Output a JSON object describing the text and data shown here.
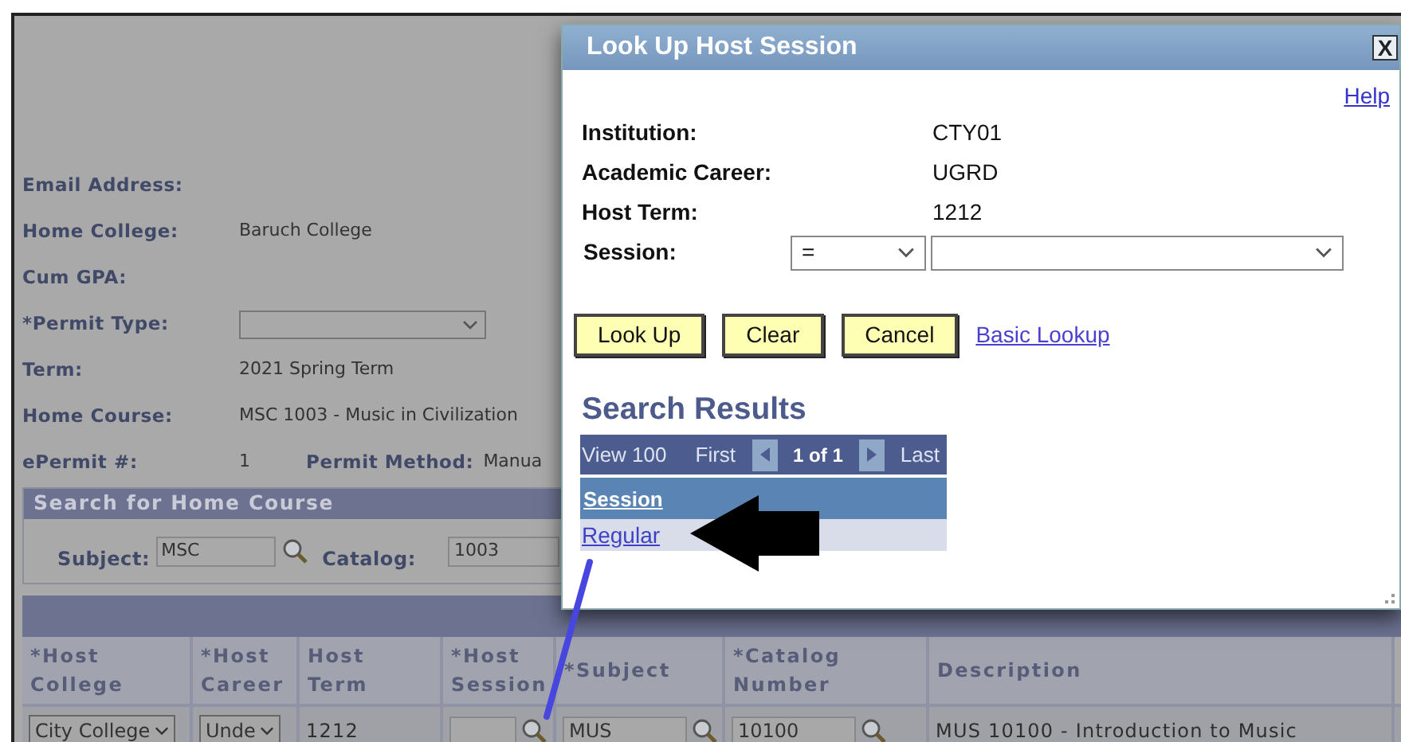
{
  "page": {
    "fields": [
      {
        "label": "Email Address:",
        "kind": "text"
      },
      {
        "label": "Home College:",
        "kind": "text",
        "value": "Baruch College"
      },
      {
        "label": "Cum GPA:",
        "kind": "text"
      },
      {
        "label": "*Permit Type:",
        "kind": "select"
      },
      {
        "label": "Term:",
        "kind": "text",
        "value": "2021 Spring Term"
      },
      {
        "label": "Home Course:",
        "kind": "text",
        "value": "MSC 1003 - Music in Civilization"
      }
    ],
    "epermit": {
      "label": "ePermit #:",
      "value": "1",
      "method_label": "Permit Method:",
      "method_value": "Manua"
    },
    "search_section": {
      "title": "Search for Home Course",
      "subject_label": "Subject:",
      "subject_value": "MSC",
      "catalog_label": "Catalog:",
      "catalog_value": "1003"
    },
    "grid": {
      "columns": [
        [
          "*Host",
          "College"
        ],
        [
          "*Host",
          "Career"
        ],
        [
          "Host",
          "Term"
        ],
        [
          "*Host",
          "Session"
        ],
        [
          "*Subject"
        ],
        [
          "*Catalog",
          "Number"
        ],
        [
          "Description"
        ]
      ],
      "row": [
        {
          "kind": "select",
          "value": "City College"
        },
        {
          "kind": "select",
          "value": "Unde"
        },
        {
          "kind": "text",
          "value": "1212"
        },
        {
          "kind": "lookup"
        },
        {
          "kind": "lookup",
          "value": "MUS"
        },
        {
          "kind": "lookup",
          "value": "10100"
        },
        {
          "kind": "text",
          "value": "MUS 10100 - Introduction to Music"
        }
      ]
    }
  },
  "dialog": {
    "title": "Look Up Host Session",
    "close": "X",
    "help": "Help",
    "criteria": [
      {
        "label": "Institution:",
        "value": "CTY01"
      },
      {
        "label": "Academic Career:",
        "value": "UGRD"
      },
      {
        "label": "Host Term:",
        "value": "1212"
      }
    ],
    "session": {
      "label": "Session:",
      "operator": "="
    },
    "buttons": [
      "Look Up",
      "Clear",
      "Cancel"
    ],
    "link": "Basic Lookup",
    "results": {
      "title": "Search Results",
      "view": "View 100",
      "first": "First",
      "count": "1 of 1",
      "last": "Last",
      "column": "Session",
      "rows": [
        "Regular"
      ]
    }
  }
}
